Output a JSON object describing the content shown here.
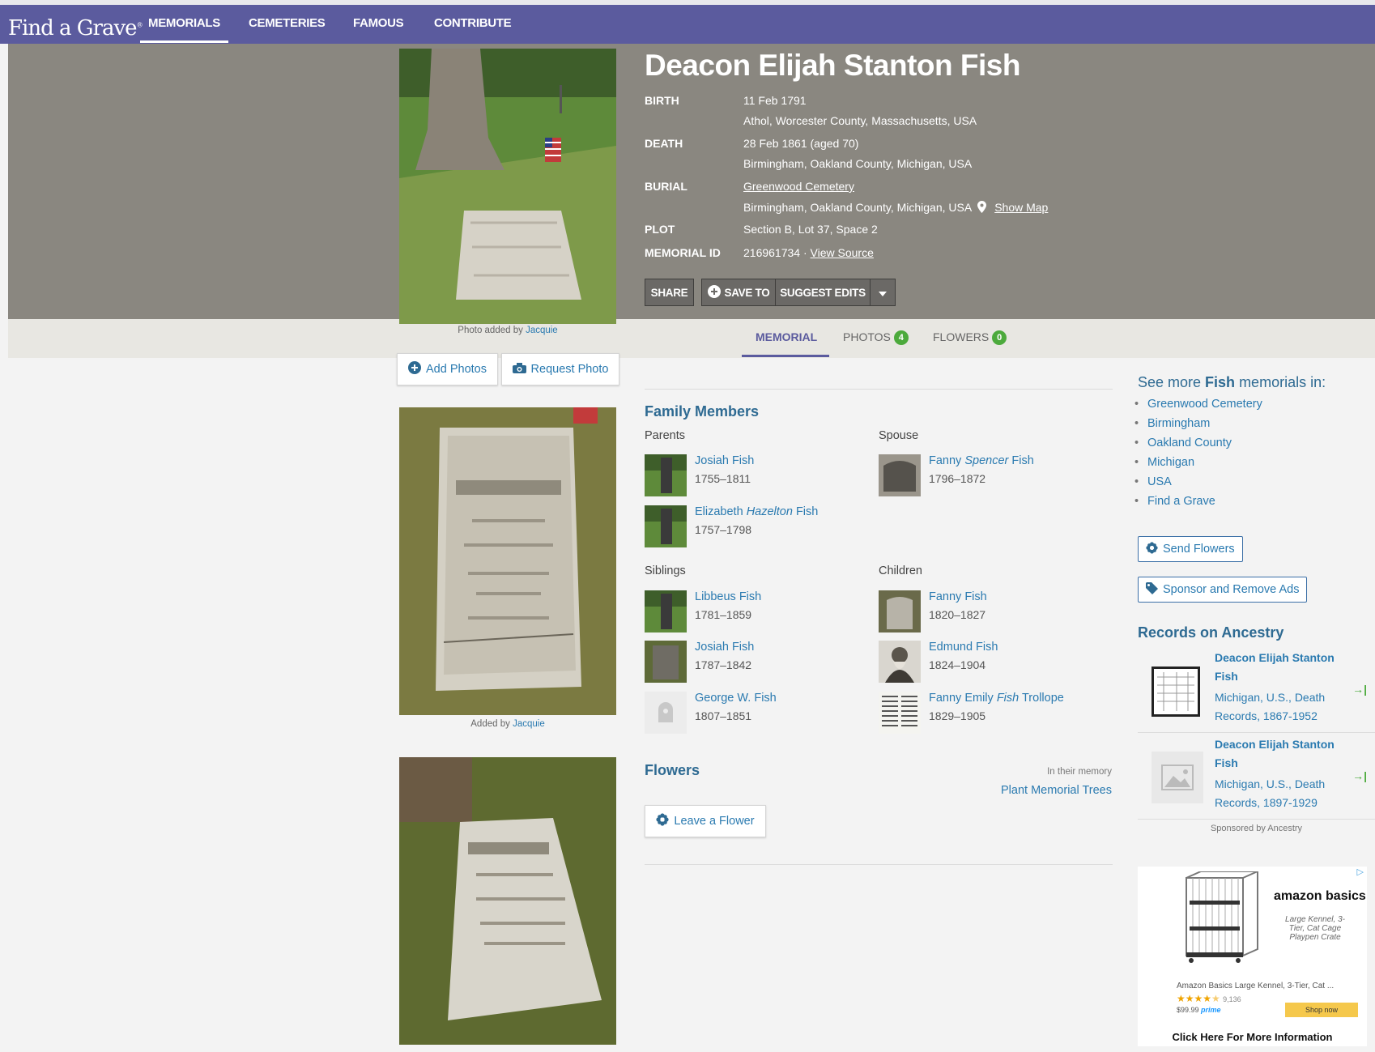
{
  "nav": {
    "logo": "Find a Grave",
    "logo_mark": "®",
    "items": [
      "MEMORIALS",
      "CEMETERIES",
      "FAMOUS",
      "CONTRIBUTE"
    ]
  },
  "memorial": {
    "name": "Deacon Elijah Stanton Fish",
    "birth_label": "BIRTH",
    "birth_date": "11 Feb 1791",
    "birth_place": "Athol, Worcester County, Massachusetts, USA",
    "death_label": "DEATH",
    "death_date": "28 Feb 1861 (aged 70)",
    "death_place": "Birmingham, Oakland County, Michigan, USA",
    "burial_label": "BURIAL",
    "burial_cemetery": "Greenwood Cemetery",
    "burial_place": "Birmingham, Oakland County, Michigan, USA",
    "show_map": "Show Map",
    "plot_label": "PLOT",
    "plot": "Section B, Lot 37, Space 2",
    "id_label": "MEMORIAL ID",
    "id": "216961734",
    "id_sep": " · ",
    "view_source": "View Source"
  },
  "actions": {
    "share": "SHARE",
    "save_to": "SAVE TO",
    "suggest_edits": "SUGGEST EDITS"
  },
  "main_photo": {
    "caption_prefix": "Photo added by",
    "caption_user": "Jacquie"
  },
  "tabs": {
    "memorial": "MEMORIAL",
    "photos": "PHOTOS",
    "photos_count": "4",
    "flowers": "FLOWERS",
    "flowers_count": "0"
  },
  "photo_buttons": {
    "add": "Add Photos",
    "request": "Request Photo"
  },
  "photo2": {
    "caption_prefix": "Added by",
    "caption_user": "Jacquie"
  },
  "family": {
    "title": "Family Members",
    "parents_label": "Parents",
    "spouse_label": "Spouse",
    "siblings_label": "Siblings",
    "children_label": "Children",
    "parents": [
      {
        "first": "Josiah Fish",
        "maiden": "",
        "last": "",
        "years": "1755–1811"
      },
      {
        "first": "Elizabeth ",
        "maiden": "Hazelton",
        "last": " Fish",
        "years": "1757–1798"
      }
    ],
    "spouse": [
      {
        "first": "Fanny ",
        "maiden": "Spencer",
        "last": " Fish",
        "years": "1796–1872"
      }
    ],
    "siblings": [
      {
        "first": "Libbeus Fish",
        "maiden": "",
        "last": "",
        "years": "1781–1859"
      },
      {
        "first": "Josiah Fish",
        "maiden": "",
        "last": "",
        "years": "1787–1842"
      },
      {
        "first": "George W. Fish",
        "maiden": "",
        "last": "",
        "years": "1807–1851"
      }
    ],
    "children": [
      {
        "first": "Fanny Fish",
        "maiden": "",
        "last": "",
        "years": "1820–1827"
      },
      {
        "first": "Edmund Fish",
        "maiden": "",
        "last": "",
        "years": "1824–1904"
      },
      {
        "first": "Fanny Emily ",
        "maiden": "Fish",
        "last": " Trollope",
        "years": "1829–1905"
      }
    ]
  },
  "flowers": {
    "title": "Flowers",
    "in_memory": "In their memory",
    "plant_trees": "Plant Memorial Trees",
    "leave": "Leave a Flower"
  },
  "sidebar": {
    "see_more_prefix": "See more ",
    "see_more_name": "Fish",
    "see_more_suffix": " memorials in:",
    "links": [
      "Greenwood Cemetery",
      "Birmingham",
      "Oakland County",
      "Michigan",
      "USA",
      "Find a Grave"
    ],
    "send_flowers": "Send Flowers",
    "sponsor": "Sponsor and Remove Ads",
    "records_title": "Records on Ancestry",
    "records": [
      {
        "title": "Deacon Elijah Stanton Fish",
        "source": "Michigan, U.S., Death Records, 1867-1952"
      },
      {
        "title": "Deacon Elijah Stanton Fish",
        "source": "Michigan, U.S., Death Records, 1897-1929"
      }
    ],
    "sponsored": "Sponsored by Ancestry"
  },
  "ad": {
    "brand": "amazon basics",
    "product": "Large Kennel, 3-Tier, Cat Cage Playpen Crate",
    "title": "Amazon Basics Large Kennel, 3-Tier, Cat ...",
    "reviews": "9,136",
    "rating": 4.5,
    "price": "$99.99",
    "prime": "prime",
    "shop": "Shop now",
    "more_info": "Click Here For More Information"
  },
  "colors": {
    "nav": "#5b5b9e",
    "hero": "#8a8780",
    "link": "#2a7ab0",
    "badge": "#4caa3c"
  }
}
